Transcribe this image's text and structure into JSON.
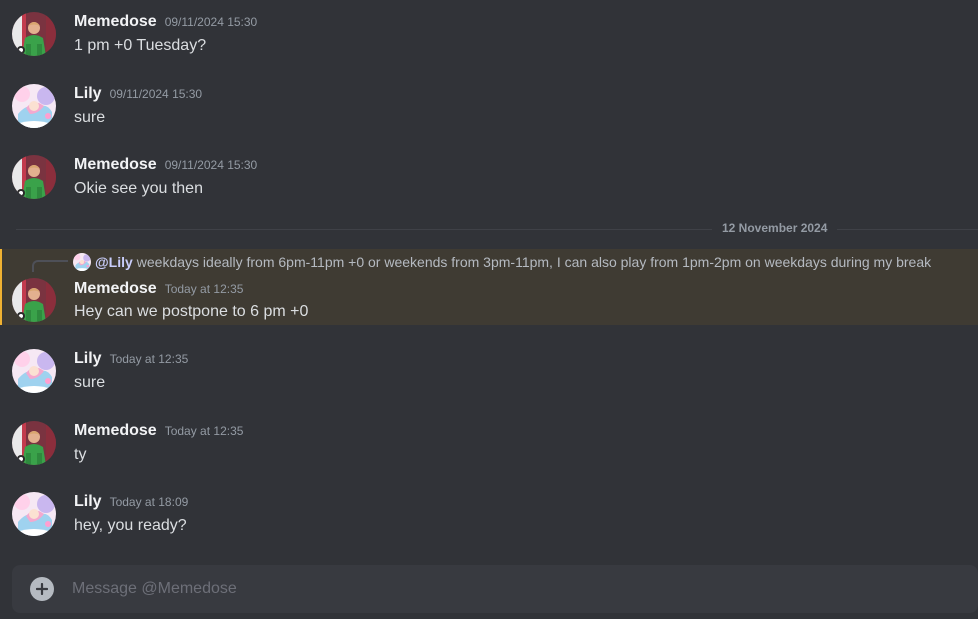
{
  "messages": [
    {
      "author": "Memedose",
      "timestamp": "09/11/2024 15:30",
      "text": "1 pm +0 Tuesday?"
    },
    {
      "author": "Lily",
      "timestamp": "09/11/2024 15:30",
      "text": "sure"
    },
    {
      "author": "Memedose",
      "timestamp": "09/11/2024 15:30",
      "text": "Okie see you then"
    },
    {
      "author": "Memedose",
      "timestamp": "Today at 12:35",
      "text": "Hey can we postpone to 6 pm +0",
      "reply": {
        "author": "@Lily",
        "text": "weekdays ideally from 6pm-11pm +0 or weekends from 3pm-11pm, I can also play from 1pm-2pm on weekdays during my break"
      }
    },
    {
      "author": "Lily",
      "timestamp": "Today at 12:35",
      "text": "sure"
    },
    {
      "author": "Memedose",
      "timestamp": "Today at 12:35",
      "text": "ty"
    },
    {
      "author": "Lily",
      "timestamp": "Today at 18:09",
      "text": "hey, you ready?"
    }
  ],
  "date_divider": "12 November 2024",
  "composer": {
    "placeholder": "Message @Memedose"
  },
  "colors": {
    "background": "#313338",
    "highlight": "#3f3b33",
    "accent": "#f0b232",
    "mention": "#c9cdfb"
  },
  "icons": {
    "add": "plus-circle-icon",
    "memedose_avatar": "goalkeeper-avatar",
    "lily_avatar": "anime-pink-avatar"
  }
}
